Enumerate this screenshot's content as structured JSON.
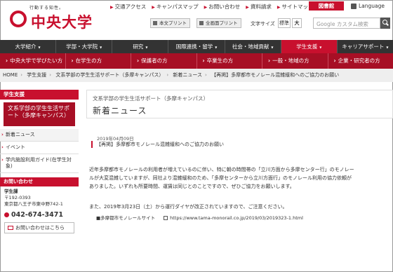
{
  "header": {
    "logo_tagline": "行動する知性。",
    "logo_text": "中央大学",
    "util_links": [
      "交通アクセス",
      "キャンパスマップ",
      "お問い合わせ",
      "資料請求",
      "サイトマップ"
    ],
    "library_button": "図書館",
    "language": "Language",
    "print_text_only": "本文プリント",
    "print_full": "全画面プリント",
    "font_size_label": "文字サイズ",
    "font_size_standard": "標準",
    "font_size_large": "大",
    "search_placeholder": "Google カスタム検索"
  },
  "global_nav": [
    "大学紹介",
    "学部・大学院",
    "研究",
    "国際連携・留学",
    "社会・地域貢献",
    "学生支援",
    "キャリアサポート"
  ],
  "sub_nav": [
    "中央大学で学びたい方",
    "在学生の方",
    "保護者の方",
    "卒業生の方",
    "一般・地域の方",
    "企業・研究者の方"
  ],
  "breadcrumb": [
    "HOME",
    "学生支援",
    "文系学部の学生生活サポート（多摩キャンパス）",
    "新着ニュース",
    "【再掲】多摩都市モノレール混雑緩和へのご協力のお願い"
  ],
  "sidebar": {
    "heading": "学生支援",
    "active_title": "文系学部の学生生活サポート（多摩キャンパス）",
    "items": [
      "新着ニュース",
      "イベント",
      "学内施設利用ガイド(在学生対象)"
    ],
    "contact_heading": "お問い合わせ",
    "office": "学生課",
    "postal": "〒192-0393",
    "address": "東京都八王子市東中野742-1",
    "phone": "042-674-3471",
    "inquiry_button": "お問い合わせはこちら"
  },
  "main": {
    "subtitle": "文系学部の学生生活サポート（多摩キャンパス）",
    "title": "新着ニュース",
    "date": "2019年04月09日",
    "news_title": "【再掲】多摩都市モノレール混雑緩和へのご協力のお願い",
    "paragraph_lines": [
      "近年多摩都市モノレールの利用者が増えているのに伴い、特に朝の時間帯の「立川方面から多摩センター行」のモノレー",
      "ルが大変混雑していますが、同社より混雑緩和のため、「多摩センターから立川方面行」のモノレール利用の協力依頼が",
      "ありました。いずれも所要時間、運賃は同じとのことですので、ぜひご協力をお願いします。"
    ],
    "notice_line": "また、2019年3月23日（土）から運行ダイヤが改正されていますので、ご注意ください。",
    "link_label": "■多摩都市モノレールサイト",
    "link_url": "https://www.tama-monorail.co.jp/2019/03/2019323-1.html"
  }
}
